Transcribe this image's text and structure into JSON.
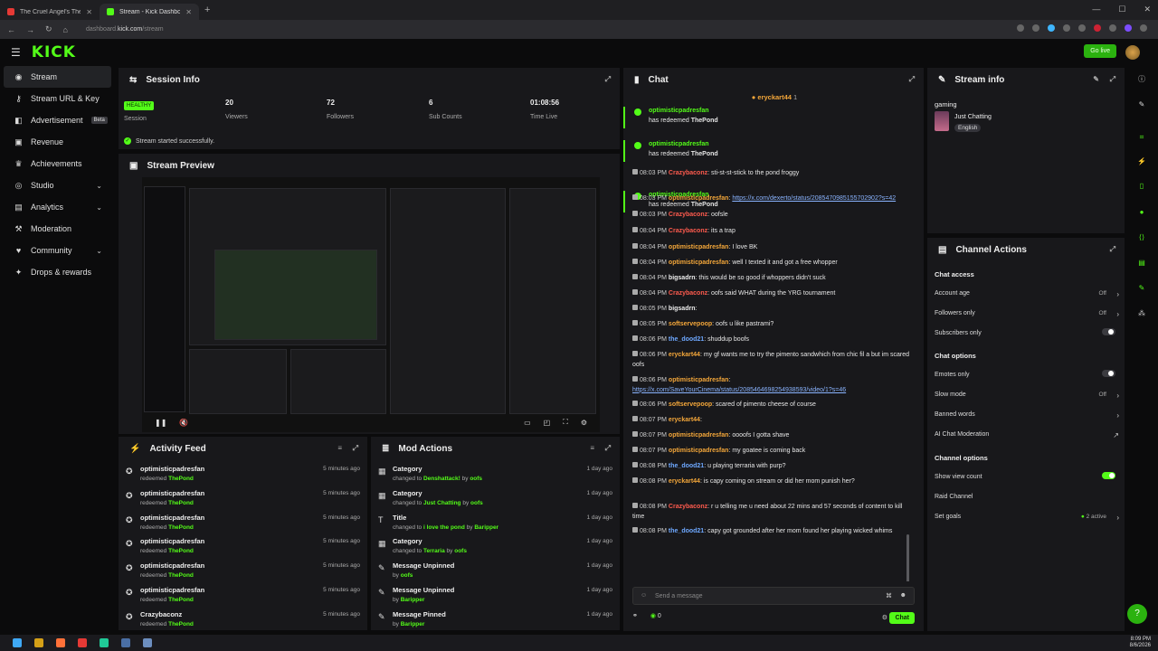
{
  "browser": {
    "tabs": [
      {
        "title": "The Cruel Angel's Thesis (E",
        "color": "#e53935"
      },
      {
        "title": "Stream - Kick Dashboard",
        "color": "#53fc18"
      }
    ],
    "url_prefix": "dashboard.",
    "url_host": "kick.com",
    "url_path": "/stream"
  },
  "topbar": {
    "logo": "KICK",
    "go_live": "Go live"
  },
  "sidebar": {
    "items": [
      {
        "label": "Stream",
        "icon": "broadcast-icon"
      },
      {
        "label": "Stream URL & Key",
        "icon": "key-icon"
      },
      {
        "label": "Advertisement",
        "icon": "megaphone-icon",
        "badge": "Beta"
      },
      {
        "label": "Revenue",
        "icon": "revenue-icon"
      },
      {
        "label": "Achievements",
        "icon": "trophy-icon"
      },
      {
        "label": "Studio",
        "icon": "studio-icon"
      },
      {
        "label": "Analytics",
        "icon": "analytics-icon"
      },
      {
        "label": "Moderation",
        "icon": "hammer-icon"
      },
      {
        "label": "Community",
        "icon": "community-icon"
      },
      {
        "label": "Drops & rewards",
        "icon": "gift-icon"
      }
    ]
  },
  "session": {
    "title": "Session Info",
    "health": "HEALTHY",
    "health_label": "Session",
    "viewers": "20",
    "viewers_label": "Viewers",
    "followers": "72",
    "followers_label": "Followers",
    "subs": "6",
    "subs_label": "Sub Counts",
    "time": "01:08:56",
    "time_label": "Time Live",
    "status": "Stream started successfully."
  },
  "preview": {
    "title": "Stream Preview"
  },
  "activity": {
    "title": "Activity Feed",
    "rows": [
      {
        "user": "optimisticpadresfan",
        "action": "redeemed",
        "item": "ThePond",
        "ago": "5 minutes ago"
      },
      {
        "user": "optimisticpadresfan",
        "action": "redeemed",
        "item": "ThePond",
        "ago": "5 minutes ago"
      },
      {
        "user": "optimisticpadresfan",
        "action": "redeemed",
        "item": "ThePond",
        "ago": "5 minutes ago"
      },
      {
        "user": "optimisticpadresfan",
        "action": "redeemed",
        "item": "ThePond",
        "ago": "5 minutes ago"
      },
      {
        "user": "optimisticpadresfan",
        "action": "redeemed",
        "item": "ThePond",
        "ago": "5 minutes ago"
      },
      {
        "user": "optimisticpadresfan",
        "action": "redeemed",
        "item": "ThePond",
        "ago": "5 minutes ago"
      },
      {
        "user": "Crazybaconz",
        "action": "redeemed",
        "item": "ThePond",
        "ago": "5 minutes ago"
      }
    ]
  },
  "mod": {
    "title": "Mod Actions",
    "rows": [
      {
        "title": "Category",
        "pre": "changed to",
        "val": "Denshattack!",
        "by": "by",
        "user": "oofs",
        "ago": "1 day ago"
      },
      {
        "title": "Category",
        "pre": "changed to",
        "val": "Just Chatting",
        "by": "by",
        "user": "oofs",
        "ago": "1 day ago"
      },
      {
        "title": "Title",
        "pre": "changed to",
        "val": "i love the pond",
        "by": "by",
        "user": "Baripper",
        "ago": "1 day ago"
      },
      {
        "title": "Category",
        "pre": "changed to",
        "val": "Terraria",
        "by": "by",
        "user": "oofs",
        "ago": "1 day ago"
      },
      {
        "title": "Message Unpinned",
        "pre": "",
        "val": "",
        "by": "by",
        "user": "oofs",
        "ago": "1 day ago"
      },
      {
        "title": "Message Unpinned",
        "pre": "",
        "val": "",
        "by": "by",
        "user": "Baripper",
        "ago": "1 day ago"
      },
      {
        "title": "Message Pinned",
        "pre": "",
        "val": "",
        "by": "by",
        "user": "Baripper",
        "ago": "1 day ago"
      }
    ]
  },
  "chat": {
    "title": "Chat",
    "pinned_user": "eryckart44",
    "pinned_count": "1",
    "redeem_user": "optimisticpadresfan",
    "redeem_text": "has redeemed",
    "redeem_item": "ThePond",
    "messages": [
      {
        "time": "08:03 PM",
        "user": "Crazybaconz",
        "color": "#ff5b4e",
        "text": "sti-st-st-stick to the pond froggy"
      },
      {
        "time": "08:03 PM",
        "user": "optimisticpadresfan",
        "color": "#f4a73a",
        "text": "https://x.com/dexerto/status/2085470985155702902?s=42"
      },
      {
        "time": "08:03 PM",
        "user": "Crazybaconz",
        "color": "#ff5b4e",
        "text": "oofsle"
      },
      {
        "time": "08:04 PM",
        "user": "Crazybaconz",
        "color": "#ff5b4e",
        "text": "its a trap"
      },
      {
        "time": "08:04 PM",
        "user": "optimisticpadresfan",
        "color": "#f4a73a",
        "text": "I love BK"
      },
      {
        "time": "08:04 PM",
        "user": "optimisticpadresfan",
        "color": "#f4a73a",
        "text": "well I texted it and got a free whopper"
      },
      {
        "time": "08:04 PM",
        "user": "bigsadrn",
        "color": "#eeeeee",
        "text": "this would be so good if whoppers didn't suck"
      },
      {
        "time": "08:04 PM",
        "user": "Crazybaconz",
        "color": "#ff5b4e",
        "text": "oofs said WHAT during the YRG tournament"
      },
      {
        "time": "08:05 PM",
        "user": "bigsadrn",
        "color": "#eeeeee",
        "text": ""
      },
      {
        "time": "08:05 PM",
        "user": "softservepoop",
        "color": "#f4a73a",
        "text": "oofs u like pastrami?"
      },
      {
        "time": "08:06 PM",
        "user": "the_dood21",
        "color": "#6ea8ff",
        "text": "shuddup boofs"
      },
      {
        "time": "08:06 PM",
        "user": "eryckart44",
        "color": "#f4a73a",
        "text": "my gf wants me to try the pimento sandwhich from chic fil a but im scared oofs"
      },
      {
        "time": "08:06 PM",
        "user": "optimisticpadresfan",
        "color": "#f4a73a",
        "text": "https://x.com/SaveYourCinema/status/2085464698254938593/video/1?s=46"
      },
      {
        "time": "08:06 PM",
        "user": "softservepoop",
        "color": "#f4a73a",
        "text": "scared of pimento cheese of course"
      },
      {
        "time": "08:07 PM",
        "user": "eryckart44",
        "color": "#f4a73a",
        "text": ""
      },
      {
        "time": "08:07 PM",
        "user": "optimisticpadresfan",
        "color": "#f4a73a",
        "text": "oooofs I gotta shave"
      },
      {
        "time": "08:07 PM",
        "user": "optimisticpadresfan",
        "color": "#f4a73a",
        "text": "my goatee is coming back"
      },
      {
        "time": "08:08 PM",
        "user": "the_dood21",
        "color": "#6ea8ff",
        "text": "u playing terraria with purp?"
      },
      {
        "time": "08:08 PM",
        "user": "eryckart44",
        "color": "#f4a73a",
        "text": "is capy coming on stream or did her mom punish her?"
      },
      {
        "time": "08:08 PM",
        "user": "Crazybaconz",
        "color": "#ff5b4e",
        "text": "r u telling me u need about 22 mins and 57 seconds of content to kill time"
      },
      {
        "time": "08:08 PM",
        "user": "the_dood21",
        "color": "#6ea8ff",
        "text": "capy got grounded after her mom found her playing wicked whims"
      }
    ],
    "input_placeholder": "Send a message",
    "viewer_count": "0",
    "send_label": "Chat"
  },
  "streaminfo": {
    "title": "Stream info",
    "category_label": "gaming",
    "category": "Just Chatting",
    "language": "English"
  },
  "channel": {
    "title": "Channel Actions",
    "access_title": "Chat access",
    "account_age": "Account age",
    "account_age_val": "Off",
    "followers_only": "Followers only",
    "followers_only_val": "Off",
    "subscribers_only": "Subscribers only",
    "options_title": "Chat options",
    "emotes_only": "Emotes only",
    "slow_mode": "Slow mode",
    "slow_mode_val": "Off",
    "banned_words": "Banned words",
    "ai_mod": "AI Chat Moderation",
    "chan_opts_title": "Channel options",
    "show_view_count": "Show view count",
    "raid": "Raid Channel",
    "goals": "Set goals",
    "goals_val": "2 active"
  },
  "taskbar": {
    "time": "8:09 PM",
    "date": "8/6/2026"
  }
}
